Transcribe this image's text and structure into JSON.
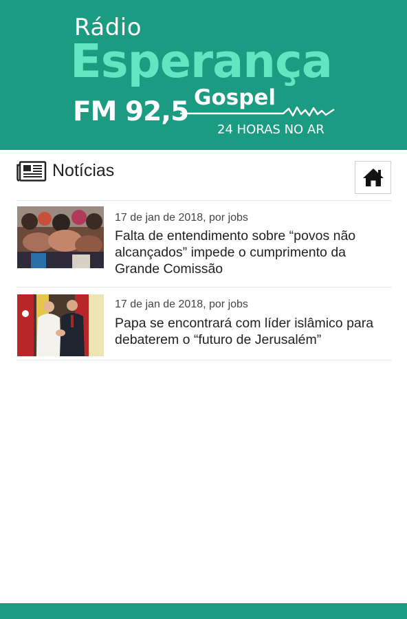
{
  "brand": {
    "radio": "Rádio",
    "name": "Esperança",
    "frequency": "FM 92,5",
    "genre": "Gospel",
    "tagline": "24 HORAS NO AR",
    "colors": {
      "primary": "#1a9b82",
      "accent": "#62e6c1"
    }
  },
  "section": {
    "icon": "newspaper-icon",
    "title": "Notícias",
    "home_icon": "home-icon"
  },
  "news": [
    {
      "meta": "17 de jan de 2018, por jobs",
      "headline": "Falta de entendimento sobre “povos não alcançados” impede o cumprimento da Grande Comissão",
      "thumbnail": "crowd-photo"
    },
    {
      "meta": "17 de jan de 2018, por jobs",
      "headline": "Papa se encontrará com líder islâmico para debaterem o “futuro de Jerusalém”",
      "thumbnail": "handshake-photo"
    }
  ]
}
